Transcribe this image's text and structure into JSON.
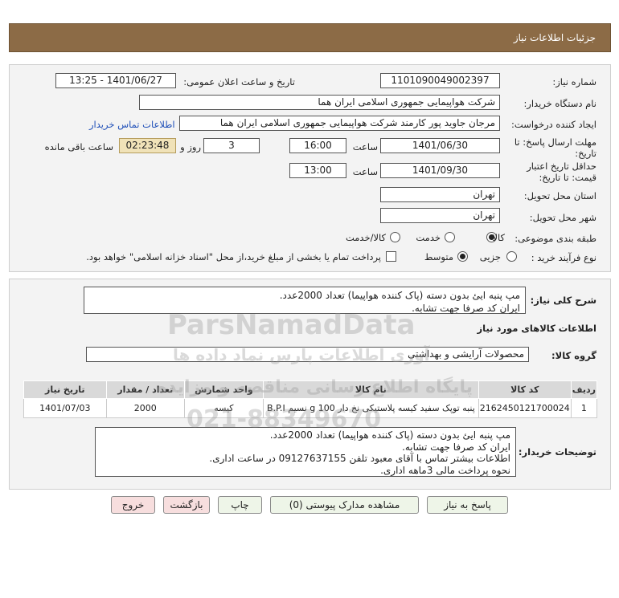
{
  "header": {
    "title": "جزئیات اطلاعات نیاز"
  },
  "form": {
    "need_number_label": "شماره نیاز:",
    "need_number": "1101090049002397",
    "announce_label": "تاریخ و ساعت اعلان عمومی:",
    "announce_value": "1401/06/27 - 13:25",
    "buyer_org_label": "نام دستگاه خریدار:",
    "buyer_org": "شرکت هواپیمایی جمهوری اسلامی ایران هما",
    "creator_label": "ایجاد کننده درخواست:",
    "creator": "مرجان جاوید پور کارمند شرکت هواپیمایی جمهوری اسلامی ایران هما",
    "contact_link": "اطلاعات تماس خریدار",
    "deadline_label_1": "مهلت ارسال پاسخ: تا",
    "deadline_label_2": "تاریخ:",
    "deadline_date": "1401/06/30",
    "time_label": "ساعت",
    "deadline_time": "16:00",
    "days": "3",
    "days_label": "روز و",
    "remaining": "02:23:48",
    "remaining_label": "ساعت باقی مانده",
    "validity_label_1": "حداقل تاریخ اعتبار",
    "validity_label_2": "قیمت: تا تاریخ:",
    "validity_date": "1401/09/30",
    "validity_time_label": "ساعت",
    "validity_time": "13:00",
    "province_label": "استان محل تحویل:",
    "province": "تهران",
    "city_label": "شهر محل تحویل:",
    "city": "تهران",
    "category_label": "طبقه بندی موضوعی:",
    "category_options": [
      "کالا",
      "خدمت",
      "کالا/خدمت"
    ],
    "process_label": "نوع فرآیند خرید :",
    "process_options": [
      "جزیی",
      "متوسط"
    ],
    "payment_note": "پرداخت تمام یا بخشی از مبلغ خرید،از محل \"اسناد خزانه اسلامی\" خواهد بود."
  },
  "need": {
    "summary_label": "شرح کلی نیاز:",
    "summary_lines": [
      "مپ پنبه ایئ بدون دسته (پاک کننده هواپیما) تعداد 2000عدد.",
      "ایران کد صرفا جهت تشابه."
    ],
    "goods_info_title": "اطلاعات کالاهای مورد نیاز",
    "group_label": "گروه کالا:",
    "group": "محصولات آرایشی و بهداشتی"
  },
  "table": {
    "headers": [
      "ردیف",
      "کد کالا",
      "نام کالا",
      "واحد شمارش",
      "تعداد / مقدار",
      "تاریخ نیاز"
    ],
    "rows": [
      [
        "1",
        "2162450121700024",
        "پنبه توپک سفید کیسه پلاستیکی نخ دار 100 g نسیم B.P.I",
        "کیسه",
        "2000",
        "1401/07/03"
      ]
    ]
  },
  "buyer_notes": {
    "label": "توضیحات خریدار:",
    "lines": [
      "مپ پنبه ایئ بدون دسته (پاک کننده هواپیما) تعداد 2000عدد.",
      "ایران کد صرفا جهت تشابه.",
      "اطلاعات بیشتر تماس با آقای معبود تلفن 09127637155 در ساعت اداری.",
      "نحوه پرداخت مالی 3ماهه اداری."
    ]
  },
  "buttons": {
    "reply": "پاسخ به نیاز",
    "attachments": "مشاهده مدارک پیوستی (0)",
    "print": "چاپ",
    "back": "بازگشت",
    "exit": "خروج"
  },
  "watermark": {
    "brand": "ParsNamadData",
    "line1": "پایگاه اطلاع رسانی مناقصه و مزایده",
    "line2": "آوری اطلاعات پارس نماد داده ها",
    "phone": "021-88349670"
  }
}
